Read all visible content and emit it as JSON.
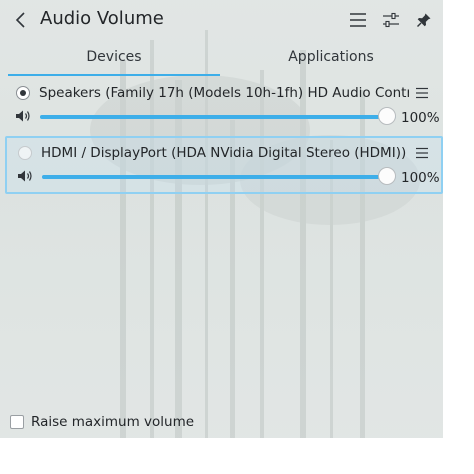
{
  "header": {
    "title": "Audio Volume",
    "icons": [
      "back-icon",
      "hamburger-menu-icon",
      "mixer-settings-icon",
      "pin-icon"
    ]
  },
  "tabs": [
    {
      "label": "Devices",
      "active": true
    },
    {
      "label": "Applications",
      "active": false
    }
  ],
  "devices": [
    {
      "name": "Speakers (Family 17h (Models 10h-1fh) HD Audio Controlle…",
      "default": true,
      "volume_percent": 100,
      "volume_text": "100%"
    },
    {
      "name": "HDMI / DisplayPort (HDA NVidia Digital Stereo (HDMI))",
      "default": false,
      "volume_percent": 100,
      "volume_text": "100%"
    }
  ],
  "footer": {
    "raise_max_label": "Raise maximum volume",
    "raise_max_checked": false
  },
  "colors": {
    "accent": "#3daee9",
    "track": "#9ed6f1",
    "selection_border": "#8fd0f2",
    "text": "#232629"
  }
}
